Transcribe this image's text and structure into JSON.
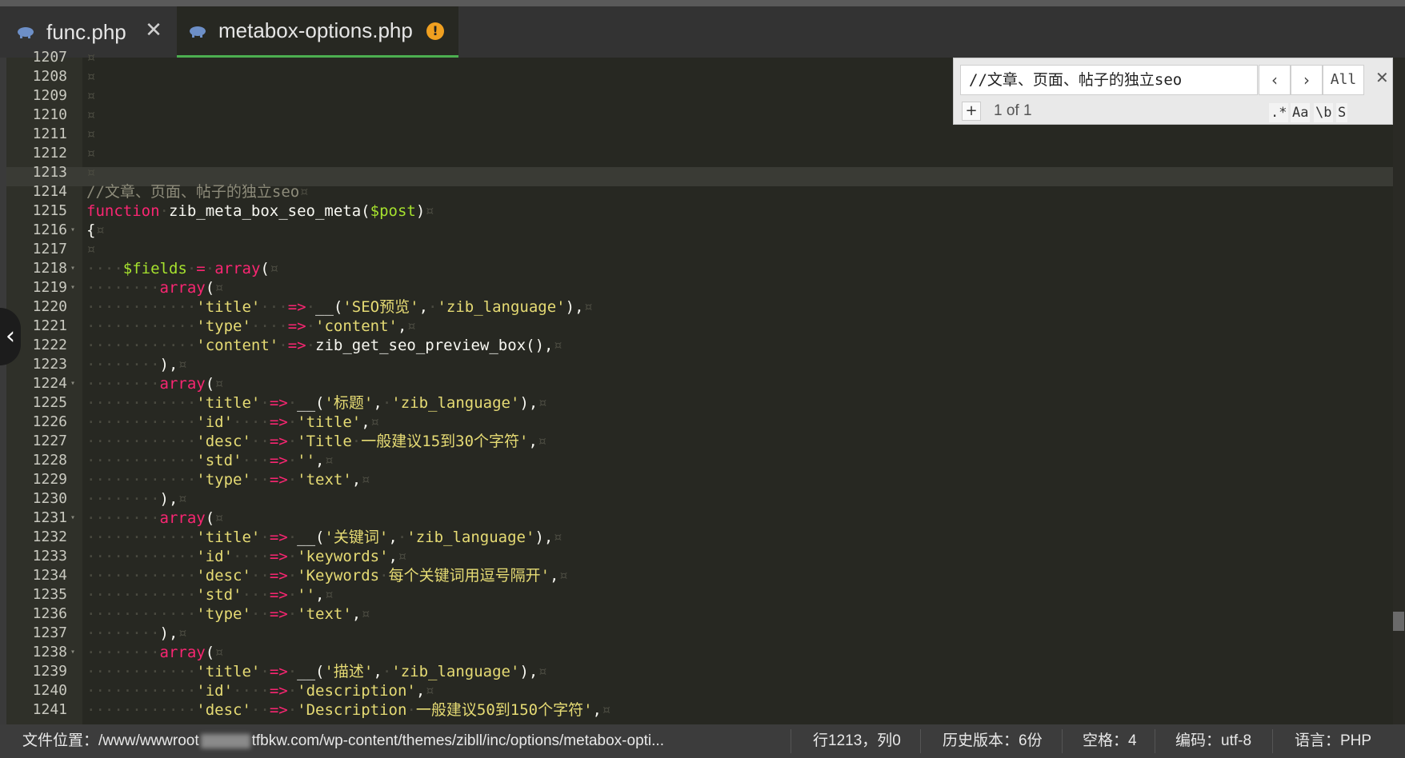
{
  "tabs": [
    {
      "label": "func.php",
      "icon": "php-elephant-icon",
      "close": "✕"
    },
    {
      "label": "metabox-options.php",
      "icon": "php-elephant-icon",
      "warning": "!",
      "active": true
    }
  ],
  "editor": {
    "current_line": 1213,
    "lines": [
      {
        "n": "1207",
        "html": "<span class='ws'>¤</span>"
      },
      {
        "n": "1208",
        "html": "<span class='ws'>¤</span>"
      },
      {
        "n": "1209",
        "html": "<span class='ws'>¤</span>"
      },
      {
        "n": "1210",
        "html": "<span class='ws'>¤</span>"
      },
      {
        "n": "1211",
        "html": "<span class='ws'>¤</span>"
      },
      {
        "n": "1212",
        "html": "<span class='ws'>¤</span>"
      },
      {
        "n": "1213",
        "html": "<span class='ws'>¤</span>"
      },
      {
        "n": "1214",
        "html": "<span class='cm'>//文章、页面、帖子的独立seo</span><span class='ws'>¤</span>"
      },
      {
        "n": "1215",
        "html": "<span class='kw'>function</span><span class='ws'>·</span>zib_meta_box_seo_meta(<span class='var'>$post</span>)<span class='ws'>¤</span>"
      },
      {
        "n": "1216",
        "fold": true,
        "html": "{<span class='ws'>¤</span>"
      },
      {
        "n": "1217",
        "html": "<span class='ws'>¤</span>"
      },
      {
        "n": "1218",
        "fold": true,
        "html": "<span class='ws'>····</span><span class='var'>$fields</span><span class='ws'>·</span><span class='op'>=</span><span class='ws'>·</span><span class='kw'>array</span>(<span class='ws'>¤</span>"
      },
      {
        "n": "1219",
        "fold": true,
        "html": "<span class='ws'>········</span><span class='kw'>array</span>(<span class='ws'>¤</span>"
      },
      {
        "n": "1220",
        "html": "<span class='ws'>············</span><span class='str'>'title'</span><span class='ws'>···</span><span class='op'>=></span><span class='ws'>·</span>__(<span class='str'>'SEO预览'</span>,<span class='ws'>·</span><span class='str'>'zib_language'</span>),<span class='ws'>¤</span>"
      },
      {
        "n": "1221",
        "html": "<span class='ws'>············</span><span class='str'>'type'</span><span class='ws'>····</span><span class='op'>=></span><span class='ws'>·</span><span class='str'>'content'</span>,<span class='ws'>¤</span>"
      },
      {
        "n": "1222",
        "html": "<span class='ws'>············</span><span class='str'>'content'</span><span class='ws'>·</span><span class='op'>=></span><span class='ws'>·</span>zib_get_seo_preview_box(),<span class='ws'>¤</span>"
      },
      {
        "n": "1223",
        "html": "<span class='ws'>········</span>),<span class='ws'>¤</span>"
      },
      {
        "n": "1224",
        "fold": true,
        "html": "<span class='ws'>········</span><span class='kw'>array</span>(<span class='ws'>¤</span>"
      },
      {
        "n": "1225",
        "html": "<span class='ws'>············</span><span class='str'>'title'</span><span class='ws'>·</span><span class='op'>=></span><span class='ws'>·</span>__(<span class='str'>'标题'</span>,<span class='ws'>·</span><span class='str'>'zib_language'</span>),<span class='ws'>¤</span>"
      },
      {
        "n": "1226",
        "html": "<span class='ws'>············</span><span class='str'>'id'</span><span class='ws'>····</span><span class='op'>=></span><span class='ws'>·</span><span class='str'>'title'</span>,<span class='ws'>¤</span>"
      },
      {
        "n": "1227",
        "html": "<span class='ws'>············</span><span class='str'>'desc'</span><span class='ws'>··</span><span class='op'>=></span><span class='ws'>·</span><span class='str'>'Title</span><span class='ws'>·</span><span class='str'>一般建议15到30个字符'</span>,<span class='ws'>¤</span>"
      },
      {
        "n": "1228",
        "html": "<span class='ws'>············</span><span class='str'>'std'</span><span class='ws'>···</span><span class='op'>=></span><span class='ws'>·</span><span class='str'>''</span>,<span class='ws'>¤</span>"
      },
      {
        "n": "1229",
        "html": "<span class='ws'>············</span><span class='str'>'type'</span><span class='ws'>··</span><span class='op'>=></span><span class='ws'>·</span><span class='str'>'text'</span>,<span class='ws'>¤</span>"
      },
      {
        "n": "1230",
        "html": "<span class='ws'>········</span>),<span class='ws'>¤</span>"
      },
      {
        "n": "1231",
        "fold": true,
        "html": "<span class='ws'>········</span><span class='kw'>array</span>(<span class='ws'>¤</span>"
      },
      {
        "n": "1232",
        "html": "<span class='ws'>············</span><span class='str'>'title'</span><span class='ws'>·</span><span class='op'>=></span><span class='ws'>·</span>__(<span class='str'>'关键词'</span>,<span class='ws'>·</span><span class='str'>'zib_language'</span>),<span class='ws'>¤</span>"
      },
      {
        "n": "1233",
        "html": "<span class='ws'>············</span><span class='str'>'id'</span><span class='ws'>····</span><span class='op'>=></span><span class='ws'>·</span><span class='str'>'keywords'</span>,<span class='ws'>¤</span>"
      },
      {
        "n": "1234",
        "html": "<span class='ws'>············</span><span class='str'>'desc'</span><span class='ws'>··</span><span class='op'>=></span><span class='ws'>·</span><span class='str'>'Keywords</span><span class='ws'>·</span><span class='str'>每个关键词用逗号隔开'</span>,<span class='ws'>¤</span>"
      },
      {
        "n": "1235",
        "html": "<span class='ws'>············</span><span class='str'>'std'</span><span class='ws'>···</span><span class='op'>=></span><span class='ws'>·</span><span class='str'>''</span>,<span class='ws'>¤</span>"
      },
      {
        "n": "1236",
        "html": "<span class='ws'>············</span><span class='str'>'type'</span><span class='ws'>··</span><span class='op'>=></span><span class='ws'>·</span><span class='str'>'text'</span>,<span class='ws'>¤</span>"
      },
      {
        "n": "1237",
        "html": "<span class='ws'>········</span>),<span class='ws'>¤</span>"
      },
      {
        "n": "1238",
        "fold": true,
        "html": "<span class='ws'>········</span><span class='kw'>array</span>(<span class='ws'>¤</span>"
      },
      {
        "n": "1239",
        "html": "<span class='ws'>············</span><span class='str'>'title'</span><span class='ws'>·</span><span class='op'>=></span><span class='ws'>·</span>__(<span class='str'>'描述'</span>,<span class='ws'>·</span><span class='str'>'zib_language'</span>),<span class='ws'>¤</span>"
      },
      {
        "n": "1240",
        "html": "<span class='ws'>············</span><span class='str'>'id'</span><span class='ws'>····</span><span class='op'>=></span><span class='ws'>·</span><span class='str'>'description'</span>,<span class='ws'>¤</span>"
      },
      {
        "n": "1241",
        "html": "<span class='ws'>············</span><span class='str'>'desc'</span><span class='ws'>··</span><span class='op'>=></span><span class='ws'>·</span><span class='str'>'Description</span><span class='ws'>·</span><span class='str'>一般建议50到150个字符'</span>,<span class='ws'>¤</span>"
      }
    ]
  },
  "find": {
    "query": "//文章、页面、帖子的独立seo",
    "prev": "‹",
    "next": "›",
    "all": "All",
    "close": "✕",
    "plus": "+",
    "count": "1 of 1",
    "regex": ".*",
    "case": "Aa",
    "word": "\\b",
    "selection": "S"
  },
  "status": {
    "path_prefix": "文件位置：/www/wwwroot",
    "path_suffix": "tfbkw.com/wp-content/themes/zibll/inc/options/metabox-opti...",
    "cursor": "行1213，列0",
    "history": "历史版本：6份",
    "indent": "空格：4",
    "encoding": "编码：utf-8",
    "language": "语言：PHP"
  },
  "colors": {
    "editor_bg": "#272822",
    "keyword": "#f92672",
    "variable": "#a6e22e",
    "string": "#e6db74",
    "comment": "#8d8b7a",
    "active_tab_underline": "#4caf50"
  }
}
